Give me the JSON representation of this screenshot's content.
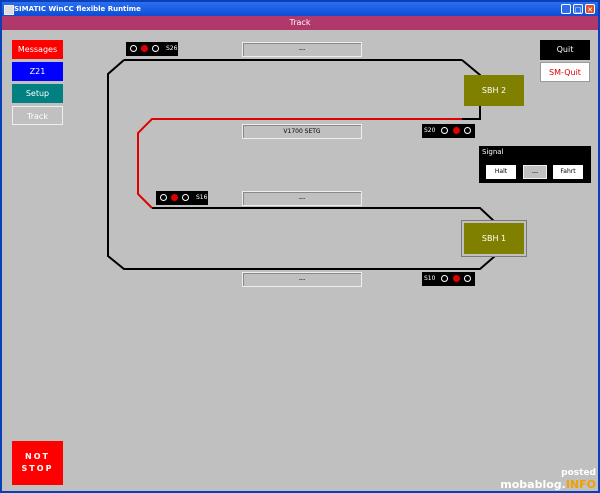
{
  "window": {
    "title": "SIMATIC WinCC flexible Runtime",
    "minimize": "_",
    "maximize": "□",
    "close": "✕"
  },
  "screen": {
    "title": "Track"
  },
  "nav": {
    "messages": "Messages",
    "z21": "Z21",
    "setup": "Setup",
    "track": "Track"
  },
  "top_right": {
    "quit": "Quit",
    "sm_quit": "SM-Quit"
  },
  "displays": {
    "top": "---",
    "middle": "V1700 SETG",
    "inner": "---",
    "bottom": "---"
  },
  "signals": {
    "s26": {
      "label": "S26",
      "lamps": [
        "off",
        "red",
        "off"
      ]
    },
    "s20": {
      "label": "S20",
      "lamps": [
        "off",
        "red",
        "off"
      ]
    },
    "s16": {
      "label": "S16",
      "lamps": [
        "off",
        "red",
        "off"
      ]
    },
    "s10": {
      "label": "S10",
      "lamps": [
        "off",
        "red",
        "off"
      ]
    }
  },
  "stations": {
    "sbh2": "SBH 2",
    "sbh1": "SBH 1"
  },
  "signal_panel": {
    "title": "Signal",
    "halt": "Halt",
    "state": "---",
    "fahrt": "Fahrt"
  },
  "emergency": {
    "line1": "NOT",
    "line2": "STOP"
  },
  "watermark": {
    "line1": "posted",
    "line2_a": "mobablog.",
    "line2_b": "INFO"
  },
  "colors": {
    "title_bar": "#0d4cd6",
    "banner": "#b0386b",
    "messages": "#ff0000",
    "z21": "#0000ff",
    "setup": "#008080",
    "station": "#808000",
    "active_track": "#e00000",
    "watermark_accent": "#f0a000"
  }
}
